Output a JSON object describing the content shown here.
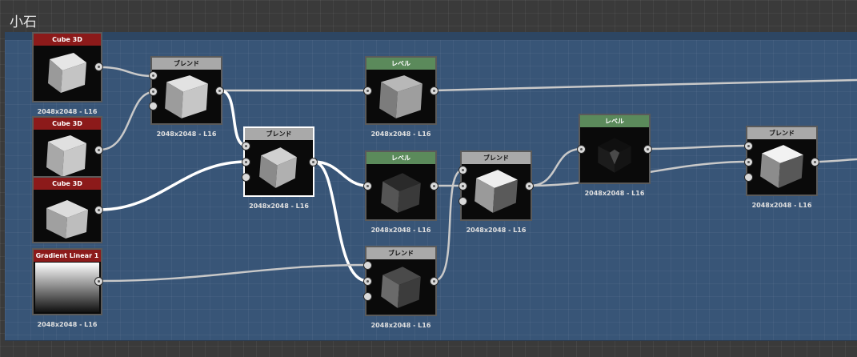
{
  "frame": {
    "title": "小石"
  },
  "nodes": {
    "cube1": {
      "title": "Cube 3D",
      "caption": "2048x2048 - L16"
    },
    "cube2": {
      "title": "Cube 3D"
    },
    "cube3": {
      "title": "Cube 3D"
    },
    "gradient": {
      "title": "Gradient Linear 1",
      "caption": "2048x2048 - L16"
    },
    "blend1": {
      "title": "ブレンド",
      "caption": "2048x2048 - L16"
    },
    "blend2": {
      "title": "ブレンド",
      "caption": "2048x2048 - L16"
    },
    "level1": {
      "title": "レベル",
      "caption": "2048x2048 - L16"
    },
    "level2": {
      "title": "レベル",
      "caption": "2048x2048 - L16"
    },
    "blend3": {
      "title": "ブレンド",
      "caption": "2048x2048 - L16"
    },
    "blend4": {
      "title": "ブレンド",
      "caption": "2048x2048 - L16"
    },
    "level3": {
      "title": "レベル",
      "caption": "2048x2048 - L16"
    },
    "blend5": {
      "title": "ブレンド",
      "caption": "2048x2048 - L16"
    }
  },
  "colors": {
    "frame_bg": "#385577",
    "canvas_bg": "#3a3a3a",
    "header_input": "#8c1a1a",
    "header_blend": "#a9a9a9",
    "header_level": "#5b8a5b",
    "wire": "#c9c9c9",
    "wire_selected": "#ffffff"
  }
}
